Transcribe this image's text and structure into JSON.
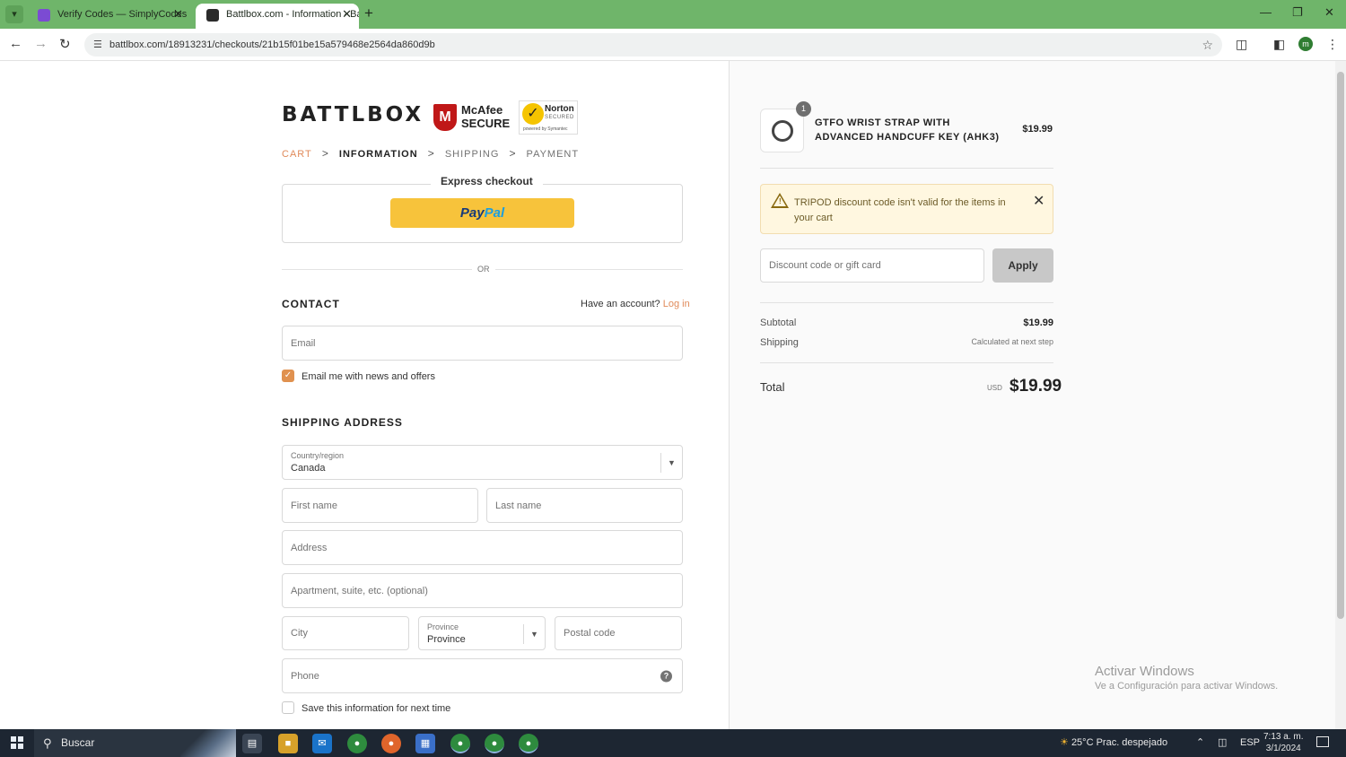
{
  "browser": {
    "tabs": [
      {
        "title": "Verify Codes — SimplyCodes"
      },
      {
        "title": "Battlbox.com - Information - Ba"
      }
    ],
    "url": "battlbox.com/18913231/checkouts/21b15f01be15a579468e2564da860d9b",
    "profile_initial": "m"
  },
  "header": {
    "logo_text": "BATTLBOX",
    "mcafee": {
      "line1": "McAfee",
      "line2": "SECURE"
    },
    "norton": {
      "line1": "Norton",
      "line2": "SECURED",
      "line3": "powered by Symantec"
    }
  },
  "breadcrumb": {
    "items": [
      "CART",
      "INFORMATION",
      "SHIPPING",
      "PAYMENT"
    ],
    "separator": ">"
  },
  "express": {
    "title": "Express checkout",
    "paypal_part1": "Pay",
    "paypal_part2": "Pal",
    "or_text": "OR"
  },
  "contact": {
    "title": "CONTACT",
    "have_account": "Have an account?",
    "login_link": "Log in",
    "email_placeholder": "Email",
    "newsletter_label": "Email me with news and offers",
    "newsletter_checked": true
  },
  "shipping": {
    "title": "SHIPPING ADDRESS",
    "country_label": "Country/region",
    "country_value": "Canada",
    "first_name_placeholder": "First name",
    "last_name_placeholder": "Last name",
    "address_placeholder": "Address",
    "apartment_placeholder": "Apartment, suite, etc. (optional)",
    "city_placeholder": "City",
    "province_label": "Province",
    "province_value": "Province",
    "postal_placeholder": "Postal code",
    "phone_placeholder": "Phone",
    "save_info_label": "Save this information for next time",
    "save_info_checked": false
  },
  "order": {
    "quantity": "1",
    "product_name": "GTFO Wrist Strap with Advanced Handcuff Key (AHK3)",
    "product_price": "$19.99",
    "warning": "TRIPOD discount code isn't valid for the items in your cart",
    "discount_placeholder": "Discount code or gift card",
    "apply_label": "Apply",
    "subtotal_label": "Subtotal",
    "subtotal_value": "$19.99",
    "shipping_label": "Shipping",
    "shipping_value": "Calculated at next step",
    "total_label": "Total",
    "total_currency": "USD",
    "total_value": "$19.99"
  },
  "windows": {
    "activate_title": "Activar Windows",
    "activate_sub": "Ve a Configuración para activar Windows.",
    "search_label": "Buscar",
    "weather": "25°C  Prac. despejado",
    "language": "ESP",
    "time": "7:13 a. m.",
    "date": "3/1/2024"
  },
  "colors": {
    "accent": "#e08a5a",
    "paypal_yellow": "#f7c33b",
    "tabbar_green": "#6fb56a",
    "warning_bg": "#fff7e0"
  }
}
